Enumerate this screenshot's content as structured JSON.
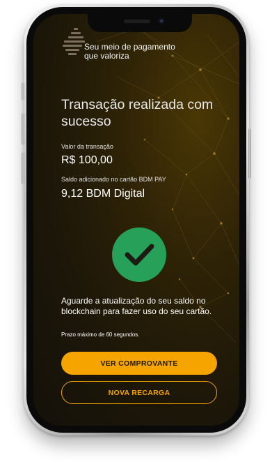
{
  "header": {
    "tagline": "Seu meio de pagamento\nque valoriza"
  },
  "main": {
    "title": "Transação realizada com sucesso",
    "amount_label": "Valor da transação",
    "amount_value": "R$ 100,00",
    "balance_label": "Saldo adicionado no cartão BDM PAY",
    "balance_value": "9,12 BDM Digital",
    "status_icon": "checkmark-circle-icon",
    "message": "Aguarde a atualização do seu saldo no blockchain para fazer uso do seu cartão.",
    "note": "Prazo máximo de 60 segundos."
  },
  "actions": {
    "primary_label": "VER COMPROVANTE",
    "secondary_label": "NOVA RECARGA"
  },
  "colors": {
    "accent": "#f6a500",
    "success": "#27a05a",
    "background": "#1d1709"
  }
}
